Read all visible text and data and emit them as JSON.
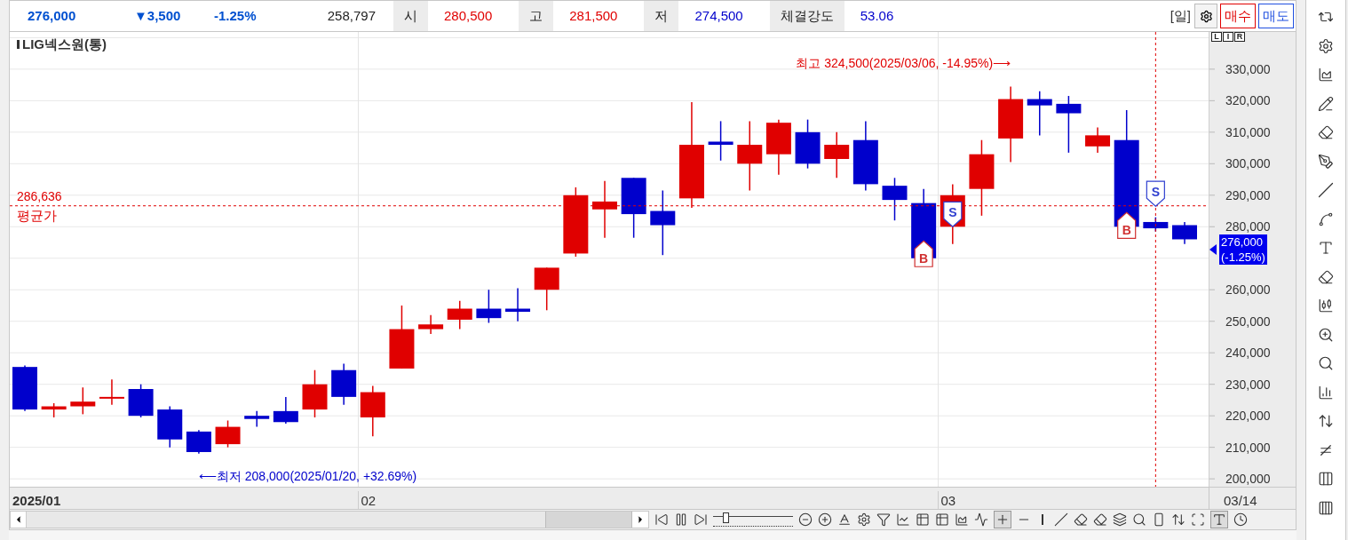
{
  "quote": {
    "price": "276,000",
    "change": "▼3,500",
    "change_rate": "-1.25%",
    "volume": "258,797",
    "fields": [
      {
        "label": "시",
        "value": "280,500",
        "color": "#e00000"
      },
      {
        "label": "고",
        "value": "281,500",
        "color": "#e00000"
      },
      {
        "label": "저",
        "value": "274,500",
        "color": "#0000cc"
      },
      {
        "label": "체결강도",
        "value": "53.06",
        "color": "#0000cc"
      }
    ]
  },
  "period": "[일]",
  "order_buttons": [
    {
      "label": "매수",
      "kind": "buy"
    },
    {
      "label": "매도",
      "kind": "sell"
    }
  ],
  "scale_buttons": [
    "L",
    "I",
    "R"
  ],
  "chart": {
    "title": "LIG넥스원(통)",
    "high_note": "최고 324,500(2025/03/06, -14.95%)⟶",
    "low_note": "⟵최저 208,000(2025/01/20, +32.69%)",
    "average_line": {
      "price": "286,636",
      "caption": "평균가"
    },
    "trade_markers": [
      {
        "kind": "buy",
        "label": "B"
      },
      {
        "kind": "sell",
        "label": "S"
      },
      {
        "kind": "buy",
        "label": "B"
      },
      {
        "kind": "sell",
        "label": "S"
      }
    ],
    "price_axis": [
      "330,000",
      "320,000",
      "310,000",
      "300,000",
      "290,000",
      "280,000",
      "260,000",
      "250,000",
      "240,000",
      "230,000",
      "220,000",
      "210,000",
      "200,000"
    ],
    "current_price_tag": {
      "price": "276,000",
      "change": "(-1.25%)"
    },
    "date_axis": [
      "2025/01",
      "02",
      "03"
    ],
    "last_date": "03/14"
  },
  "toolbar": {
    "crosshair": true,
    "text_labels": true
  },
  "zoom_slider": {
    "level": 0.15
  }
}
